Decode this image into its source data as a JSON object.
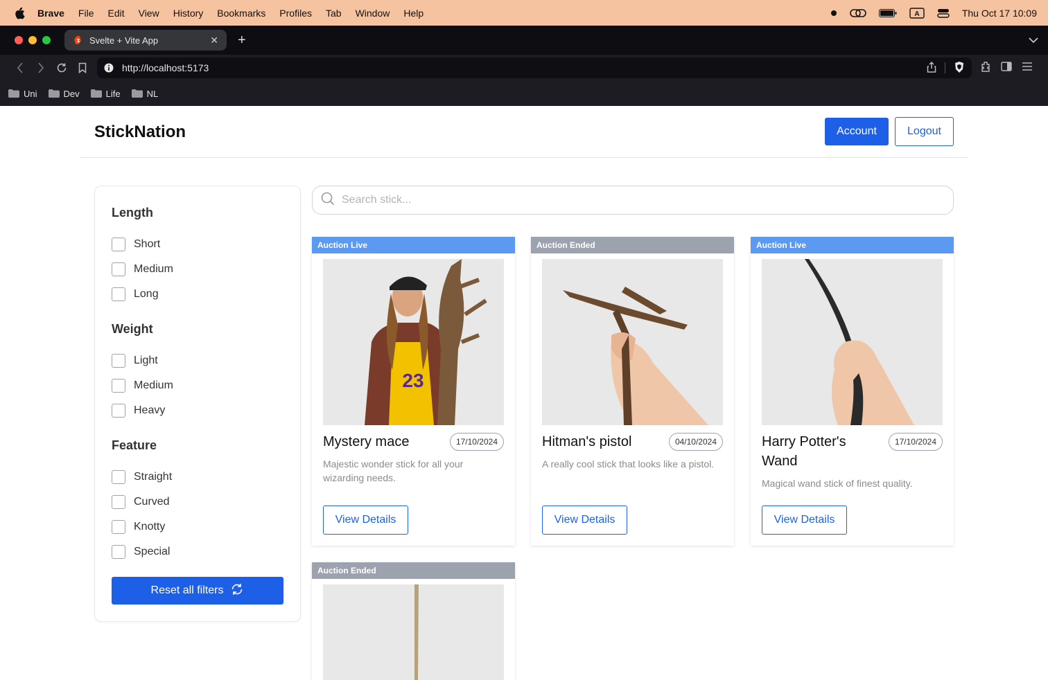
{
  "menubar": {
    "app": "Brave",
    "items": [
      "File",
      "Edit",
      "View",
      "History",
      "Bookmarks",
      "Profiles",
      "Tab",
      "Window",
      "Help"
    ],
    "datetime": "Thu Oct 17  10:09"
  },
  "browser": {
    "tab_title": "Svelte + Vite App",
    "url": "http://localhost:5173",
    "bookmarks": [
      "Uni",
      "Dev",
      "Life",
      "NL"
    ]
  },
  "app": {
    "brand": "StickNation",
    "account_label": "Account",
    "logout_label": "Logout"
  },
  "filters": {
    "groups": [
      {
        "title": "Length",
        "options": [
          "Short",
          "Medium",
          "Long"
        ]
      },
      {
        "title": "Weight",
        "options": [
          "Light",
          "Medium",
          "Heavy"
        ]
      },
      {
        "title": "Feature",
        "options": [
          "Straight",
          "Curved",
          "Knotty",
          "Special"
        ]
      }
    ],
    "reset_label": "Reset all filters"
  },
  "search": {
    "placeholder": "Search stick..."
  },
  "cards": [
    {
      "status": "Auction Live",
      "title": "Mystery mace",
      "date": "17/10/2024",
      "desc": "Majestic wonder stick for all your wizarding needs.",
      "button": "View Details"
    },
    {
      "status": "Auction Ended",
      "title": "Hitman's pistol",
      "date": "04/10/2024",
      "desc": "A really cool stick that looks like a pistol.",
      "button": "View Details"
    },
    {
      "status": "Auction Live",
      "title": "Harry Potter's Wand",
      "date": "17/10/2024",
      "desc": "Magical wand stick of finest quality.",
      "button": "View Details"
    },
    {
      "status": "Auction Ended"
    }
  ],
  "colors": {
    "accent": "#1d5fe6",
    "live": "#5b9af0",
    "ended": "#9ca3af",
    "menubar": "#f6c3a0"
  }
}
